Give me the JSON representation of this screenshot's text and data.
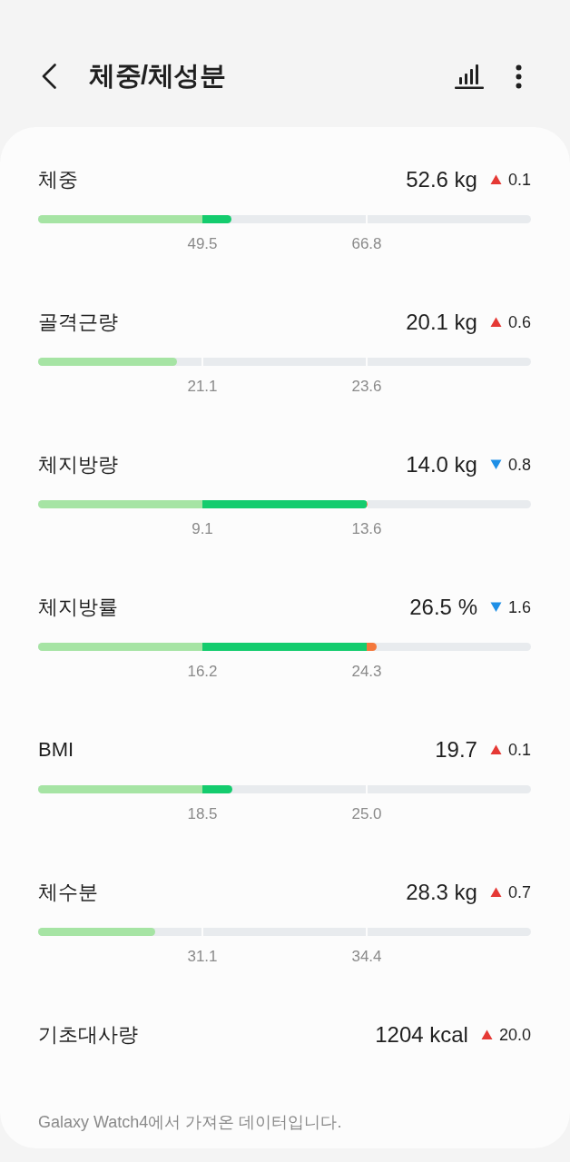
{
  "header": {
    "title": "체중/체성분"
  },
  "metrics": [
    {
      "kind": "range",
      "label": "체중",
      "value": "52.6 kg",
      "increased": true,
      "change": "0.1",
      "level": 0.392,
      "ticks": [
        "49.5",
        "66.8"
      ]
    },
    {
      "kind": "range",
      "label": "골격근량",
      "value": "20.1 kg",
      "increased": true,
      "change": "0.6",
      "level": 0.282,
      "ticks": [
        "21.1",
        "23.6"
      ]
    },
    {
      "kind": "range",
      "label": "체지방량",
      "value": "14.0 kg",
      "increased": false,
      "change": "0.8",
      "level": 0.668,
      "ticks": [
        "9.1",
        "13.6"
      ]
    },
    {
      "kind": "range",
      "label": "체지방률",
      "value": "26.5 %",
      "increased": false,
      "change": "1.6",
      "level": 0.687,
      "ticks": [
        "16.2",
        "24.3"
      ]
    },
    {
      "kind": "range",
      "label": "BMI",
      "value": "19.7",
      "increased": true,
      "change": "0.1",
      "level": 0.394,
      "ticks": [
        "18.5",
        "25.0"
      ]
    },
    {
      "kind": "range",
      "label": "체수분",
      "value": "28.3 kg",
      "increased": true,
      "change": "0.7",
      "level": 0.238,
      "ticks": [
        "31.1",
        "34.4"
      ]
    },
    {
      "kind": "plain",
      "label": "기초대사량",
      "value": "1204 kcal",
      "increased": true,
      "change": "20.0"
    }
  ],
  "footnote": "Galaxy Watch4에서 가져온 데이터입니다."
}
